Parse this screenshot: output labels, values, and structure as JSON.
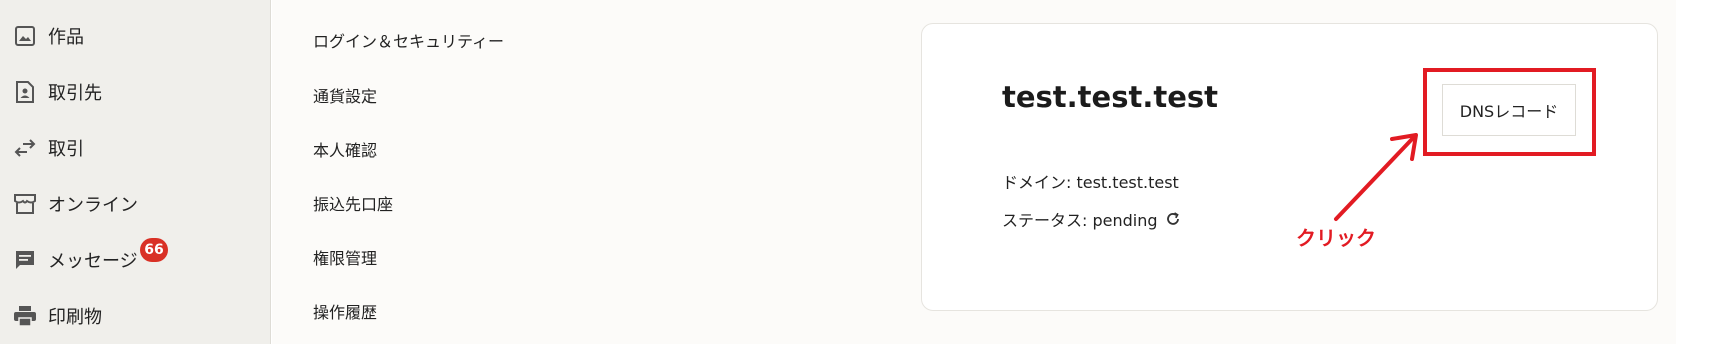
{
  "sidebar": {
    "items": [
      {
        "label": "作品",
        "icon": "image-icon"
      },
      {
        "label": "取引先",
        "icon": "contact-file-icon"
      },
      {
        "label": "取引",
        "icon": "swap-arrows-icon"
      },
      {
        "label": "オンライン",
        "icon": "storefront-icon"
      },
      {
        "label": "メッセージ",
        "icon": "message-icon",
        "badge": "66"
      },
      {
        "label": "印刷物",
        "icon": "printer-icon"
      }
    ]
  },
  "settings_menu": {
    "items": [
      "ログイン＆セキュリティー",
      "通貨設定",
      "本人確認",
      "振込先口座",
      "権限管理",
      "操作履歴"
    ]
  },
  "domain_card": {
    "title": "test.test.test",
    "domain_label": "ドメイン: test.test.test",
    "status_label": "ステータス: pending",
    "dns_button": "DNSレコード"
  },
  "annotation": {
    "text": "クリック",
    "color": "#e21b23"
  },
  "colors": {
    "sidebar_bg": "#f0efeb",
    "badge": "#d93025",
    "annotation_red": "#e21b23"
  }
}
